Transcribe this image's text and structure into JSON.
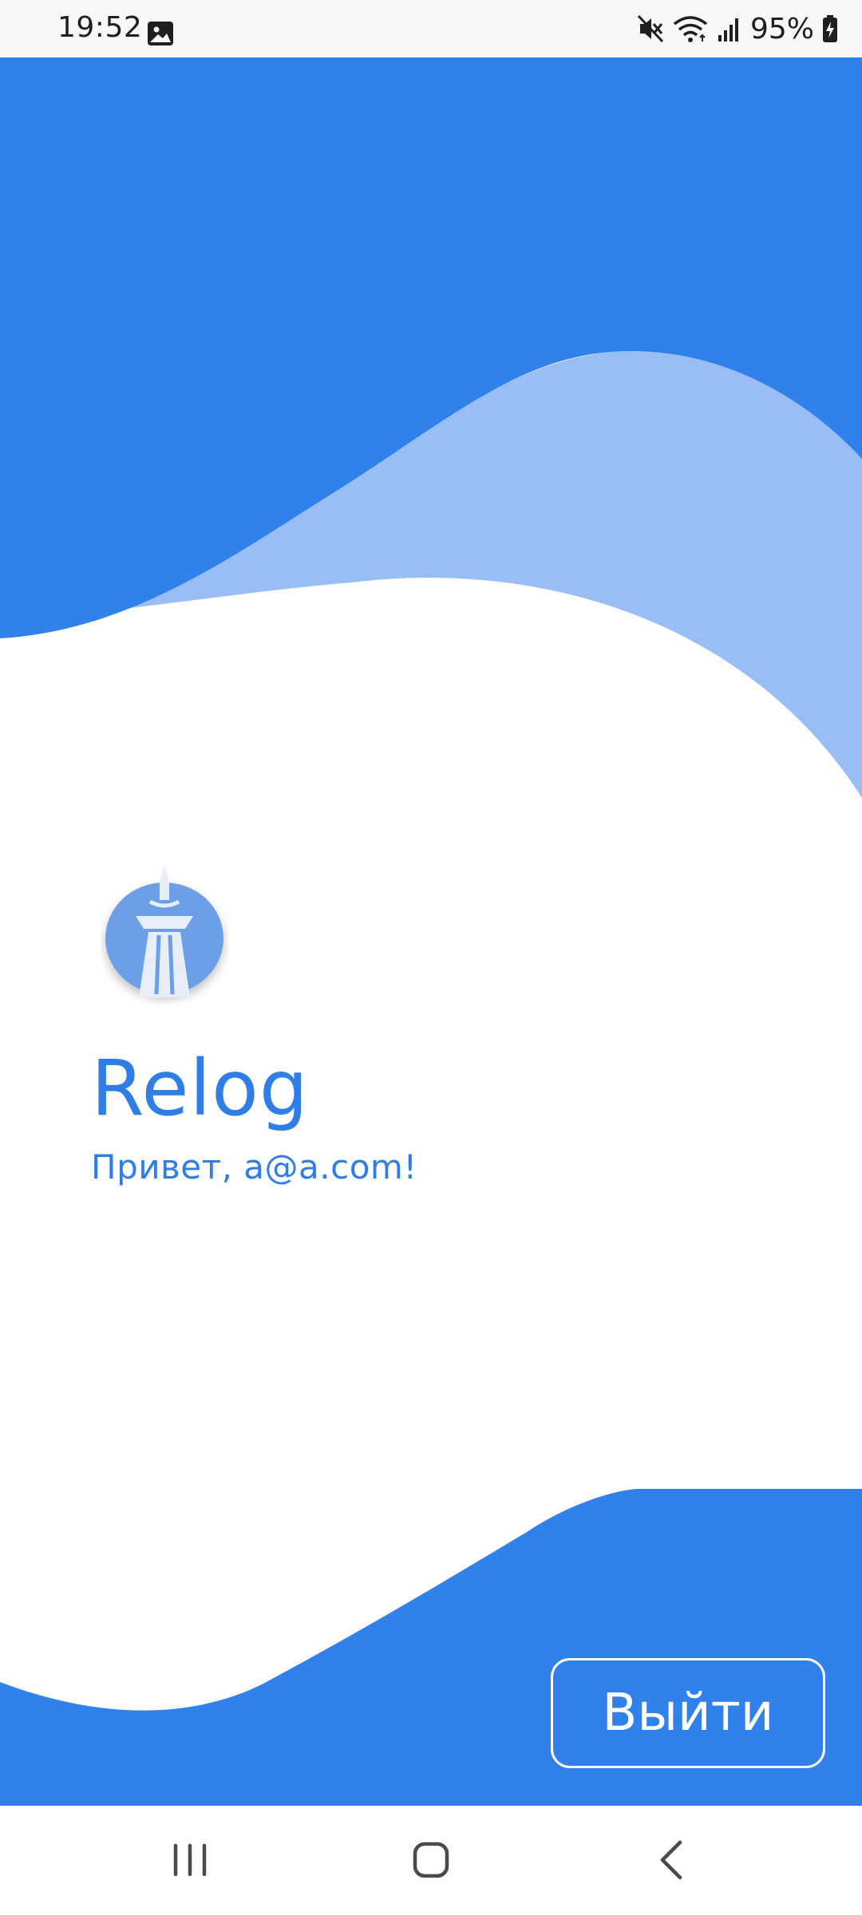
{
  "status_bar": {
    "time": "19:52",
    "battery_percent": "95%",
    "icons": [
      "gallery-notification-icon",
      "mute-icon",
      "wifi-icon",
      "signal-icon",
      "battery-charging-icon"
    ]
  },
  "app": {
    "title": "Relog",
    "greeting": "Привет, a@a.com!",
    "logo_icon": "tower-logo-icon"
  },
  "actions": {
    "logout_label": "Выйти"
  },
  "nav_bar": {
    "icons": [
      "recents-icon",
      "home-icon",
      "back-icon"
    ]
  },
  "colors": {
    "primary": "#3081EA",
    "wave_light": "#99BEF5",
    "background": "#FFFFFF",
    "status_bar": "#F7F7F9"
  }
}
